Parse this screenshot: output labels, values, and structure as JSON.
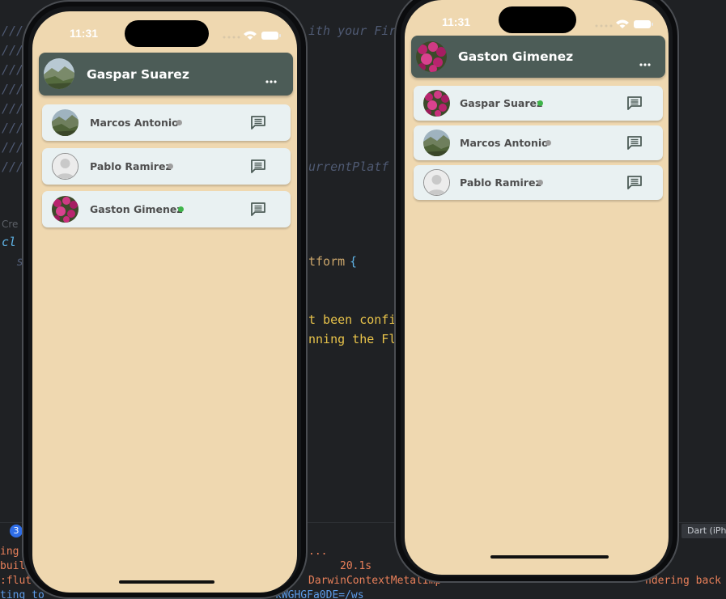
{
  "editor": {
    "lines": [
      {
        "text": "///",
        "cls": "c-comment"
      },
      {
        "text": "ith your Fir",
        "cls": "c-comment"
      },
      {
        "text": "///",
        "cls": "c-comment"
      },
      {
        "text": "///",
        "cls": "c-comment"
      },
      {
        "text": "///",
        "cls": "c-comment"
      },
      {
        "text": "///",
        "cls": "c-comment"
      },
      {
        "text": "///",
        "cls": "c-comment"
      },
      {
        "text": "///",
        "cls": "c-comment"
      },
      {
        "text": "urrentPlatf",
        "cls": "c-comment"
      },
      {
        "text": "///",
        "cls": "c-comment"
      },
      {
        "text": "Cre",
        "cls": "c-gray"
      },
      {
        "text": "cl",
        "cls": "c-kw"
      },
      {
        "text": "s",
        "cls": "c-comment"
      },
      {
        "text": "tform",
        "cls": "c-ident"
      },
      {
        "text": "{",
        "cls": "c-brace"
      },
      {
        "text": "t been confi",
        "cls": "c-string"
      },
      {
        "text": "nning the Fl",
        "cls": "c-string"
      }
    ],
    "console_badge": "3",
    "dart_tag": "Dart (iPh",
    "console_lines": [
      "ing",
      "buil",
      ":flut",
      "ting to"
    ],
    "console_mid": "...",
    "console_time": "20.1s",
    "console_darwin": "DarwinContextMetalImp",
    "console_rendering": "ndering back",
    "console_ws": "kWGHGFa0DE=/ws"
  },
  "left_phone": {
    "time": "11:31",
    "header": {
      "name": "Gaspar Suarez",
      "avatar": "landscape"
    },
    "contacts": [
      {
        "name": "Marcos Antonio",
        "status": "offline",
        "avatar": "landscape"
      },
      {
        "name": "Pablo Ramirez",
        "status": "offline",
        "avatar": "placeholder"
      },
      {
        "name": "Gaston Gimenez",
        "status": "online",
        "avatar": "flowers"
      }
    ]
  },
  "right_phone": {
    "time": "11:31",
    "header": {
      "name": "Gaston Gimenez",
      "avatar": "flowers"
    },
    "contacts": [
      {
        "name": "Gaspar Suarez",
        "status": "online",
        "avatar": "flowers"
      },
      {
        "name": "Marcos Antonio",
        "status": "offline",
        "avatar": "landscape"
      },
      {
        "name": "Pablo Ramirez",
        "status": "offline",
        "avatar": "placeholder"
      }
    ]
  },
  "colors": {
    "screen_bg": "#efd8b0",
    "appbar_bg": "#4c5c57",
    "card_bg": "#e9f1f2",
    "online": "#3fb54a",
    "offline": "#9e9e9e"
  },
  "icons": {
    "more": "more-horizontal-icon",
    "chat": "chat-bubble-icon",
    "wifi": "wifi-icon",
    "battery": "battery-icon",
    "signal": "signal-icon"
  }
}
